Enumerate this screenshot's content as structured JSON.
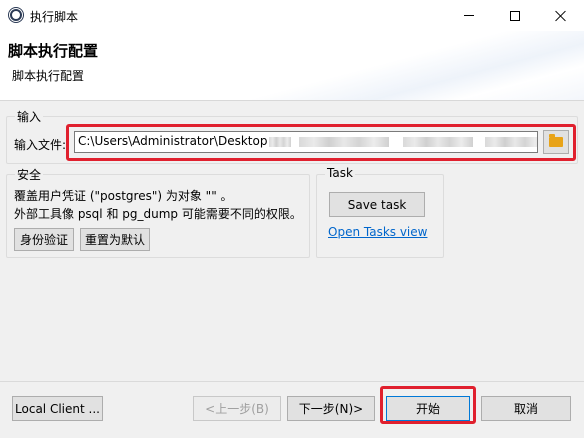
{
  "window": {
    "title": "执行脚本"
  },
  "header": {
    "title": "脚本执行配置",
    "subtitle": "脚本执行配置"
  },
  "input_section": {
    "label": "输入",
    "file_label": "输入文件:",
    "file_value": "C:\\Users\\Administrator\\Desktop"
  },
  "security_section": {
    "label": "安全",
    "line1": "覆盖用户凭证 (\"postgres\") 为对象 \"\" 。",
    "line2": "外部工具像 psql 和 pg_dump 可能需要不同的权限。",
    "auth_button": "身份验证",
    "reset_button": "重置为默认"
  },
  "task_section": {
    "label": "Task",
    "save_button": "Save task",
    "open_link": "Open Tasks view"
  },
  "footer": {
    "local_client": "Local Client ...",
    "prev": "<上一步(B)",
    "next": "下一步(N)>",
    "start": "开始",
    "cancel": "取消"
  },
  "colors": {
    "highlight": "#e0202e",
    "link": "#0066cc",
    "folder": "#e8a317"
  }
}
